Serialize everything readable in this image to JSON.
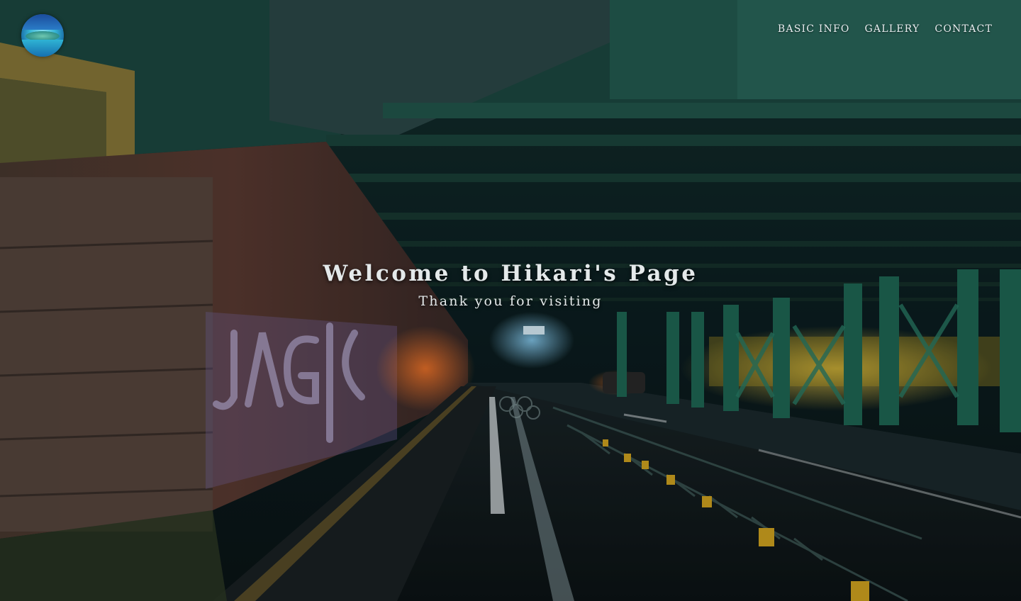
{
  "header": {
    "logo_icon": "island-ocean-logo-icon",
    "nav": [
      {
        "label": "BASIC INFO"
      },
      {
        "label": "GALLERY"
      },
      {
        "label": "CONTACT"
      }
    ]
  },
  "hero": {
    "title": "Welcome to Hikari's Page",
    "subtitle": "Thank you for visiting",
    "background_image": "night-street-under-elevated-railway-photo"
  },
  "colors": {
    "nav_text": "#e8eef0",
    "hero_text": "#e4e9ea",
    "steel_green": "#1f5a4e"
  }
}
